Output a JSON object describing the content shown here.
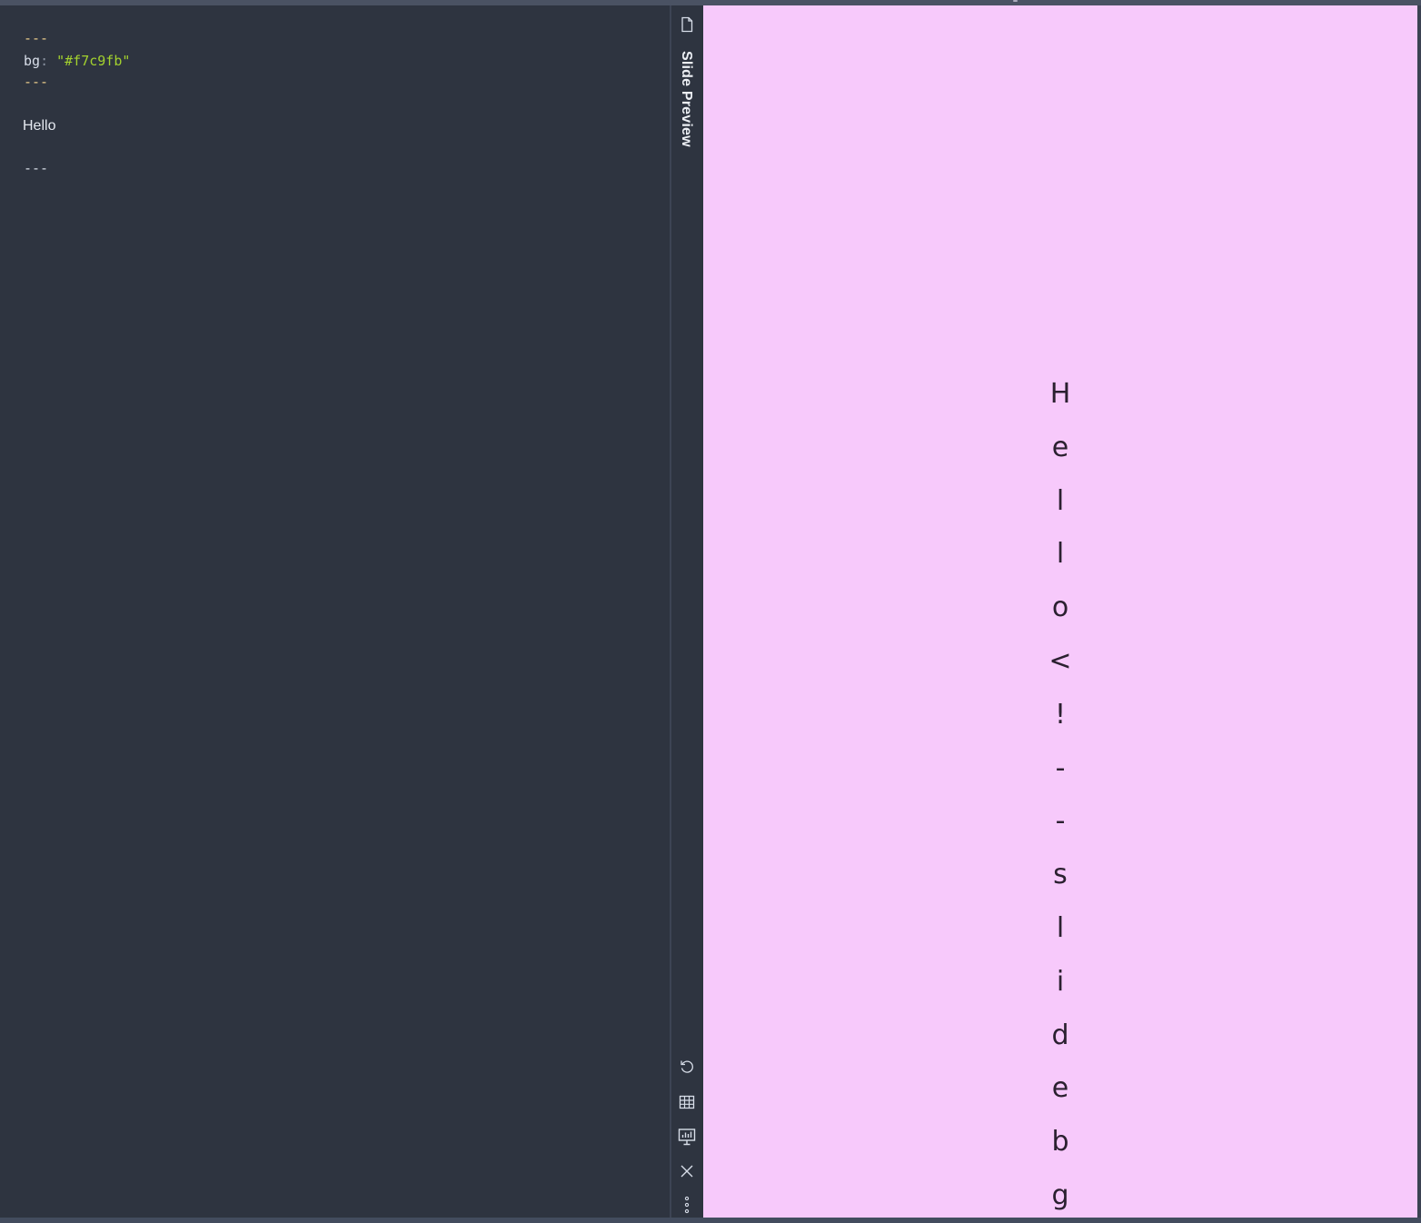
{
  "editor": {
    "frontmatter_open": "---",
    "frontmatter_key": "bg",
    "frontmatter_colon": ":",
    "frontmatter_value": "\"#f7c9fb\"",
    "frontmatter_close": "---",
    "body_text": "Hello",
    "slide_separator": "---"
  },
  "sidebar": {
    "title": "Slide Preview",
    "icons": [
      "file-icon",
      "refresh-icon",
      "grid-icon",
      "presentation-icon",
      "close-icon",
      "more-icon"
    ]
  },
  "preview": {
    "background": "#f7c9fb",
    "chars": [
      "H",
      "e",
      "l",
      "l",
      "o",
      "<",
      "!",
      "-",
      "-",
      "s",
      "l",
      "i",
      "d",
      "e",
      "b",
      "g"
    ]
  }
}
